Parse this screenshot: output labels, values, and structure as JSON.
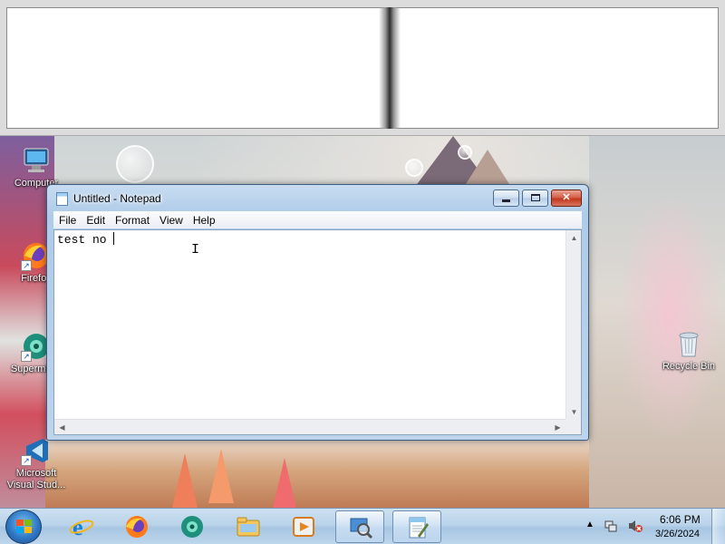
{
  "desktop": {
    "icons": [
      {
        "label": "Computer",
        "icon": "computer-icon"
      },
      {
        "label": "Firefox",
        "icon": "firefox-icon"
      },
      {
        "label": "Supermium",
        "icon": "supermium-icon"
      },
      {
        "label": "Microsoft Visual Stud...",
        "icon": "visual-studio-icon"
      },
      {
        "label": "Recycle Bin",
        "icon": "recycle-bin-icon"
      }
    ]
  },
  "notepad": {
    "title": "Untitled - Notepad",
    "menu": [
      "File",
      "Edit",
      "Format",
      "View",
      "Help"
    ],
    "text": "test no ",
    "buttons": {
      "minimize": "minimize",
      "maximize": "maximize",
      "close": "close"
    }
  },
  "taskbar": {
    "pinned": [
      {
        "icon": "internet-explorer-icon"
      },
      {
        "icon": "firefox-icon"
      },
      {
        "icon": "supermium-icon"
      },
      {
        "icon": "file-explorer-icon"
      },
      {
        "icon": "media-player-icon"
      },
      {
        "icon": "magnifier-icon",
        "active": true
      },
      {
        "icon": "notepad-icon",
        "active": true
      }
    ],
    "tray": {
      "time": "6:06 PM",
      "date": "3/26/2024"
    }
  },
  "colors": {
    "taskbar": "#b9d3ea",
    "title_bar": "#aecbe8",
    "close_button": "#c2381d"
  }
}
